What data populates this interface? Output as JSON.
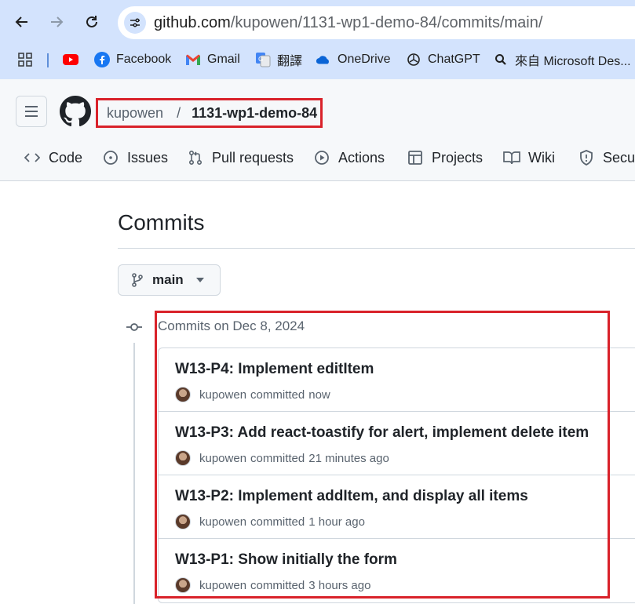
{
  "browser": {
    "url_host": "github.com",
    "url_path": "/kupowen/1131-wp1-demo-84/commits/main/",
    "bookmarks": [
      {
        "label": "",
        "icon": "apps-grid-icon"
      },
      {
        "label": "",
        "icon": "youtube-icon"
      },
      {
        "label": "Facebook",
        "icon": "facebook-icon"
      },
      {
        "label": "Gmail",
        "icon": "gmail-icon"
      },
      {
        "label": "翻譯",
        "icon": "google-translate-icon"
      },
      {
        "label": "OneDrive",
        "icon": "onedrive-icon"
      },
      {
        "label": "ChatGPT",
        "icon": "chatgpt-icon"
      },
      {
        "label": "來自 Microsoft Des...",
        "icon": "search-icon"
      }
    ]
  },
  "repo": {
    "owner": "kupowen",
    "separator": "/",
    "name": "1131-wp1-demo-84",
    "tabs": [
      {
        "label": "Code",
        "icon": "code-icon"
      },
      {
        "label": "Issues",
        "icon": "issues-icon"
      },
      {
        "label": "Pull requests",
        "icon": "pull-request-icon"
      },
      {
        "label": "Actions",
        "icon": "actions-icon"
      },
      {
        "label": "Projects",
        "icon": "projects-icon"
      },
      {
        "label": "Wiki",
        "icon": "wiki-icon"
      },
      {
        "label": "Secur",
        "icon": "security-icon"
      }
    ]
  },
  "page": {
    "title": "Commits",
    "branch": "main",
    "group_date": "Commits on Dec 8, 2024"
  },
  "commits": [
    {
      "title": "W13-P4: Implement editItem",
      "author": "kupowen",
      "verb": "committed",
      "time": "now"
    },
    {
      "title": "W13-P3: Add react-toastify for alert, implement delete item",
      "author": "kupowen",
      "verb": "committed",
      "time": "21 minutes ago"
    },
    {
      "title": "W13-P2: Implement addItem, and display all items",
      "author": "kupowen",
      "verb": "committed",
      "time": "1 hour ago"
    },
    {
      "title": "W13-P1: Show initially the form",
      "author": "kupowen",
      "verb": "committed",
      "time": "3 hours ago"
    }
  ],
  "colors": {
    "chrome_bar": "#d3e3fd",
    "highlight": "#d9222a",
    "muted_text": "#59636e",
    "border": "#d0d7de"
  }
}
